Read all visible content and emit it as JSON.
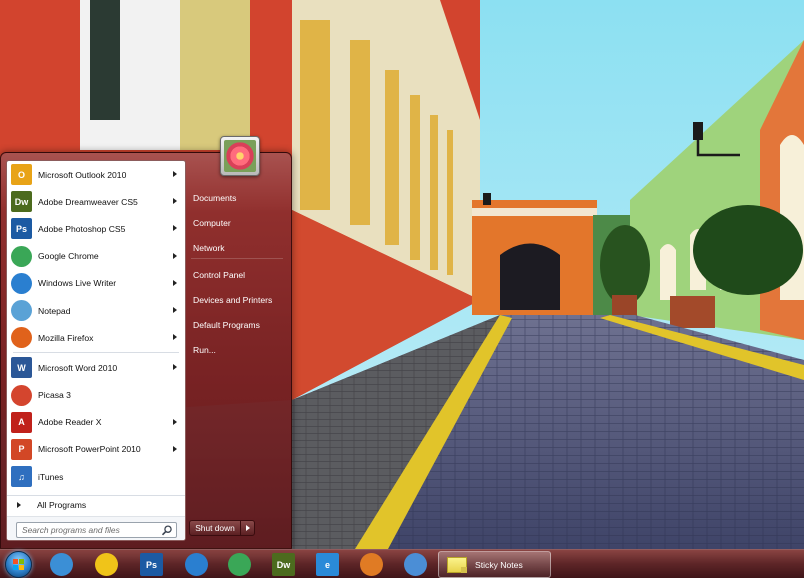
{
  "start_menu": {
    "pinned_programs": [
      {
        "label": "Microsoft Outlook 2010",
        "icon": "outlook-icon",
        "glyph": "O",
        "color": "#e8a317",
        "submenu": true
      },
      {
        "label": "Adobe Dreamweaver CS5",
        "icon": "dreamweaver-icon",
        "glyph": "Dw",
        "color": "#4c6b1e",
        "submenu": true
      },
      {
        "label": "Adobe Photoshop CS5",
        "icon": "photoshop-icon",
        "glyph": "Ps",
        "color": "#1c5aa3",
        "submenu": true
      },
      {
        "label": "Google Chrome",
        "icon": "chrome-icon",
        "glyph": "",
        "color": "#3aa757",
        "submenu": true
      },
      {
        "label": "Windows Live Writer",
        "icon": "live-writer-icon",
        "glyph": "",
        "color": "#2a7fd0",
        "submenu": true
      },
      {
        "label": "Notepad",
        "icon": "notepad-icon",
        "glyph": "",
        "color": "#5aa2d6",
        "submenu": true
      },
      {
        "label": "Mozilla Firefox",
        "icon": "firefox-icon",
        "glyph": "",
        "color": "#e0621b",
        "submenu": true
      }
    ],
    "recent_programs": [
      {
        "label": "Microsoft Word 2010",
        "icon": "word-icon",
        "glyph": "W",
        "color": "#2b5797",
        "submenu": true
      },
      {
        "label": "Picasa 3",
        "icon": "picasa-icon",
        "glyph": "",
        "color": "#d4452e",
        "submenu": false
      },
      {
        "label": "Adobe Reader X",
        "icon": "acrobat-reader-icon",
        "glyph": "A",
        "color": "#c0211b",
        "submenu": true
      },
      {
        "label": "Microsoft PowerPoint 2010",
        "icon": "powerpoint-icon",
        "glyph": "P",
        "color": "#d24726",
        "submenu": true
      },
      {
        "label": "iTunes",
        "icon": "itunes-icon",
        "glyph": "♫",
        "color": "#2f6fbf",
        "submenu": false
      }
    ],
    "all_programs_label": "All Programs",
    "search_placeholder": "Search programs and files",
    "right_items": [
      "Documents",
      "Computer",
      "Network",
      "Control Panel",
      "Devices and Printers",
      "Default Programs",
      "Run..."
    ],
    "shutdown_label": "Shut down"
  },
  "taskbar": {
    "start_button": "windows-orb-icon",
    "pinned": [
      {
        "icon": "live-messenger-icon",
        "glyph": "",
        "color": "#3b8fd6"
      },
      {
        "icon": "rubber-duck-icon",
        "glyph": "",
        "color": "#f0c419"
      },
      {
        "icon": "photoshop-icon",
        "glyph": "Ps",
        "color": "#1c5aa3"
      },
      {
        "icon": "live-writer-icon",
        "glyph": "",
        "color": "#2a7fd0"
      },
      {
        "icon": "chrome-icon",
        "glyph": "",
        "color": "#3aa757"
      },
      {
        "icon": "dreamweaver-icon",
        "glyph": "Dw",
        "color": "#4c6b1e"
      },
      {
        "icon": "internet-explorer-icon",
        "glyph": "e",
        "color": "#2a8ad8"
      },
      {
        "icon": "eye-app-icon",
        "glyph": "",
        "color": "#e07b24"
      },
      {
        "icon": "paint-brush-icon",
        "glyph": "",
        "color": "#4b8ed6"
      }
    ],
    "active_window": {
      "label": "Sticky Notes",
      "icon": "sticky-notes-icon"
    }
  }
}
